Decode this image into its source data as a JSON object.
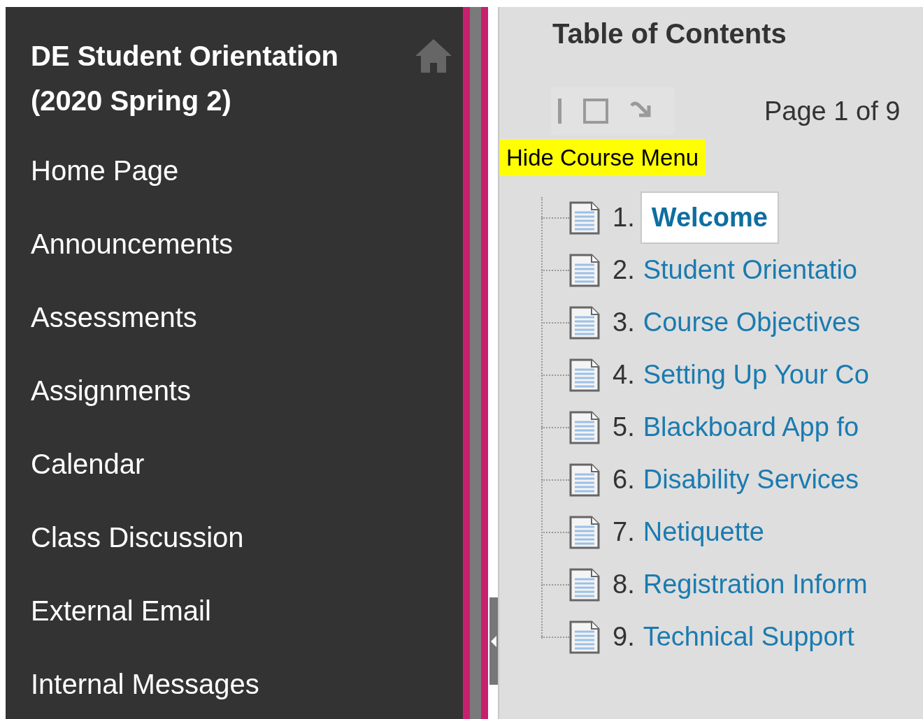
{
  "sidebar": {
    "course_title": "DE Student Orientation (2020 Spring 2)",
    "items": [
      {
        "label": "Home Page"
      },
      {
        "label": "Announcements"
      },
      {
        "label": "Assessments"
      },
      {
        "label": "Assignments"
      },
      {
        "label": "Calendar"
      },
      {
        "label": "Class Discussion"
      },
      {
        "label": "External Email"
      },
      {
        "label": "Internal Messages"
      }
    ]
  },
  "content": {
    "title": "Table of Contents",
    "page_info": "Page 1 of 9",
    "hide_menu_link": "Hide Course Menu",
    "toc": [
      {
        "number": "1.",
        "title": "Welcome",
        "selected": true
      },
      {
        "number": "2.",
        "title": "Student Orientatio",
        "selected": false
      },
      {
        "number": "3.",
        "title": "Course Objectives",
        "selected": false
      },
      {
        "number": "4.",
        "title": "Setting Up Your Co",
        "selected": false
      },
      {
        "number": "5.",
        "title": "Blackboard App fo",
        "selected": false
      },
      {
        "number": "6.",
        "title": "Disability Services",
        "selected": false
      },
      {
        "number": "7.",
        "title": "Netiquette",
        "selected": false
      },
      {
        "number": "8.",
        "title": "Registration Inform",
        "selected": false
      },
      {
        "number": "9.",
        "title": "Technical Support",
        "selected": false
      }
    ]
  }
}
